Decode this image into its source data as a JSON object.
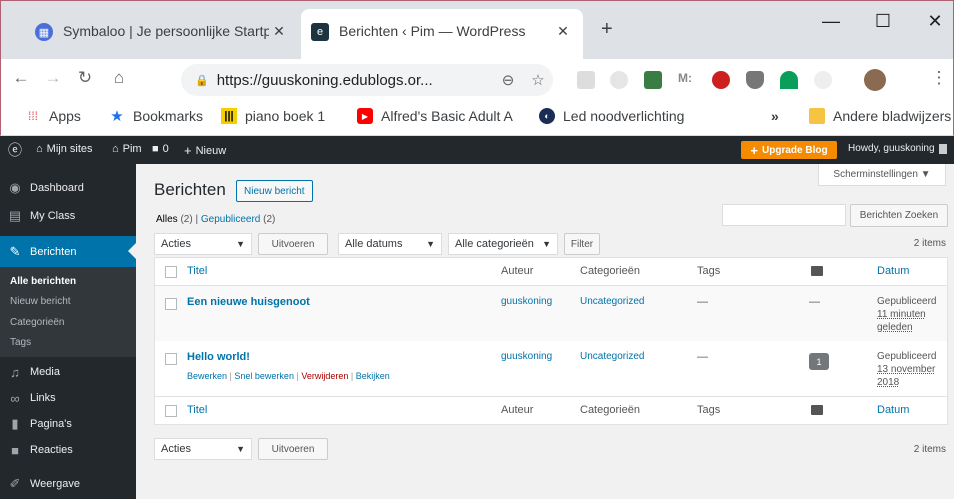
{
  "browser": {
    "tabs": [
      {
        "title": "Symbaloo | Je persoonlijke Startp",
        "close": "✕"
      },
      {
        "title": "Berichten ‹ Pim — WordPress",
        "close": "✕"
      }
    ],
    "new_tab": "+",
    "window": {
      "minimize": "—",
      "maximize": "☐",
      "close": "✕"
    },
    "url": "https://guuskoning.edublogs.or...",
    "bookmarks": [
      {
        "label": "Apps",
        "icon": "apps-icon"
      },
      {
        "label": "Bookmarks",
        "icon": "star-icon"
      },
      {
        "label": "piano boek 1",
        "icon": "piano-icon"
      },
      {
        "label": "Alfred's Basic Adult A",
        "icon": "youtube-icon"
      },
      {
        "label": "Led noodverlichting",
        "icon": "globe-icon"
      }
    ],
    "overflow": "»",
    "other_bookmarks": "Andere bladwijzers"
  },
  "adminbar": {
    "my_sites": "Mijn sites",
    "site": "Pim",
    "comments": "0",
    "new": "Nieuw",
    "upgrade": "Upgrade Blog",
    "howdy": "Howdy, guuskoning"
  },
  "sidebar": {
    "items": [
      {
        "label": "Dashboard",
        "icon": "dashboard-icon"
      },
      {
        "label": "My Class",
        "icon": "class-icon"
      },
      {
        "label": "Berichten",
        "icon": "pin-icon"
      },
      {
        "label": "Media",
        "icon": "media-icon"
      },
      {
        "label": "Links",
        "icon": "links-icon"
      },
      {
        "label": "Pagina's",
        "icon": "pages-icon"
      },
      {
        "label": "Reacties",
        "icon": "comments-icon"
      },
      {
        "label": "Weergave",
        "icon": "appearance-icon"
      }
    ],
    "submenu": [
      "Alle berichten",
      "Nieuw bericht",
      "Categorieën",
      "Tags"
    ]
  },
  "main": {
    "screen_options": "Scherminstellingen ▼",
    "title": "Berichten",
    "new_post": "Nieuw bericht",
    "views": {
      "all": "Alles",
      "all_count": "(2)",
      "sep": "|",
      "published": "Gepubliceerd",
      "published_count": "(2)"
    },
    "search_button": "Berichten Zoeken",
    "bulk_action": "Acties",
    "apply": "Uitvoeren",
    "dates": "Alle datums",
    "categories": "Alle categorieën",
    "filter": "Filter",
    "items_count": "2 items",
    "columns": {
      "title": "Titel",
      "author": "Auteur",
      "categories": "Categorieën",
      "tags": "Tags",
      "date": "Datum"
    },
    "posts": [
      {
        "title": "Een nieuwe huisgenoot",
        "author": "guuskoning",
        "category": "Uncategorized",
        "tags": "—",
        "comments": "—",
        "status": "Gepubliceerd",
        "date_line1": "11 minuten",
        "date_line2": "geleden"
      },
      {
        "title": "Hello world!",
        "author": "guuskoning",
        "category": "Uncategorized",
        "tags": "—",
        "comments": "1",
        "status": "Gepubliceerd",
        "date_line1": "13 november",
        "date_line2": "2018",
        "actions": {
          "edit": "Bewerken",
          "quick_edit": "Snel bewerken",
          "trash": "Verwijderen",
          "view": "Bekijken",
          "sep": "|"
        }
      }
    ]
  }
}
